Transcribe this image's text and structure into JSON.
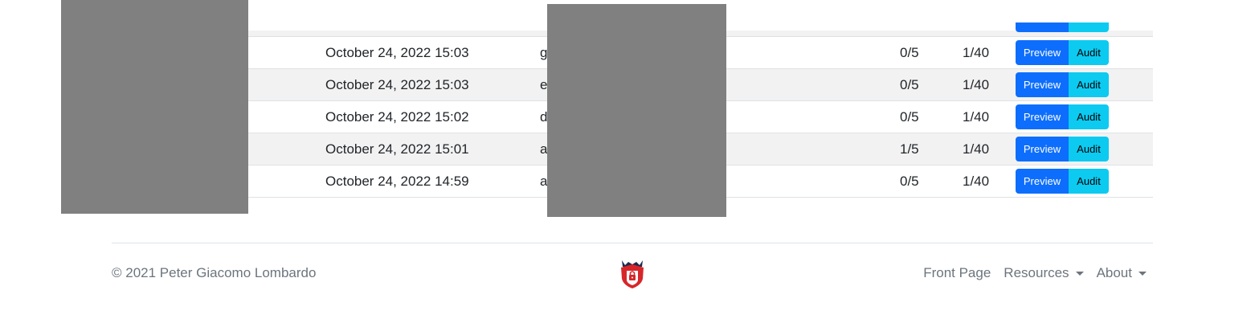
{
  "table": {
    "rows": [
      {
        "date": "October 24, 2022 15:03",
        "name": "g",
        "score": "0/5",
        "questions": "1/40",
        "preview": "Preview",
        "audit": "Audit"
      },
      {
        "date": "October 24, 2022 15:03",
        "name": "e",
        "score": "0/5",
        "questions": "1/40",
        "preview": "Preview",
        "audit": "Audit"
      },
      {
        "date": "October 24, 2022 15:02",
        "name": "d",
        "score": "0/5",
        "questions": "1/40",
        "preview": "Preview",
        "audit": "Audit"
      },
      {
        "date": "October 24, 2022 15:01",
        "name": "a",
        "score": "1/5",
        "questions": "1/40",
        "preview": "Preview",
        "audit": "Audit"
      },
      {
        "date": "October 24, 2022 14:59",
        "name": "a",
        "score": "0/5",
        "questions": "1/40",
        "preview": "Preview",
        "audit": "Audit"
      }
    ]
  },
  "footer": {
    "copyright": "© 2021 Peter Giacomo Lombardo",
    "logo_icon": "shield-lock-logo-icon",
    "nav": {
      "front_page": "Front Page",
      "resources": "Resources",
      "about": "About"
    }
  },
  "colors": {
    "preview_button": "#0d6efd",
    "audit_button": "#0dcaf0",
    "logo_red": "#d7262b",
    "logo_dark": "#1d2b4f"
  }
}
